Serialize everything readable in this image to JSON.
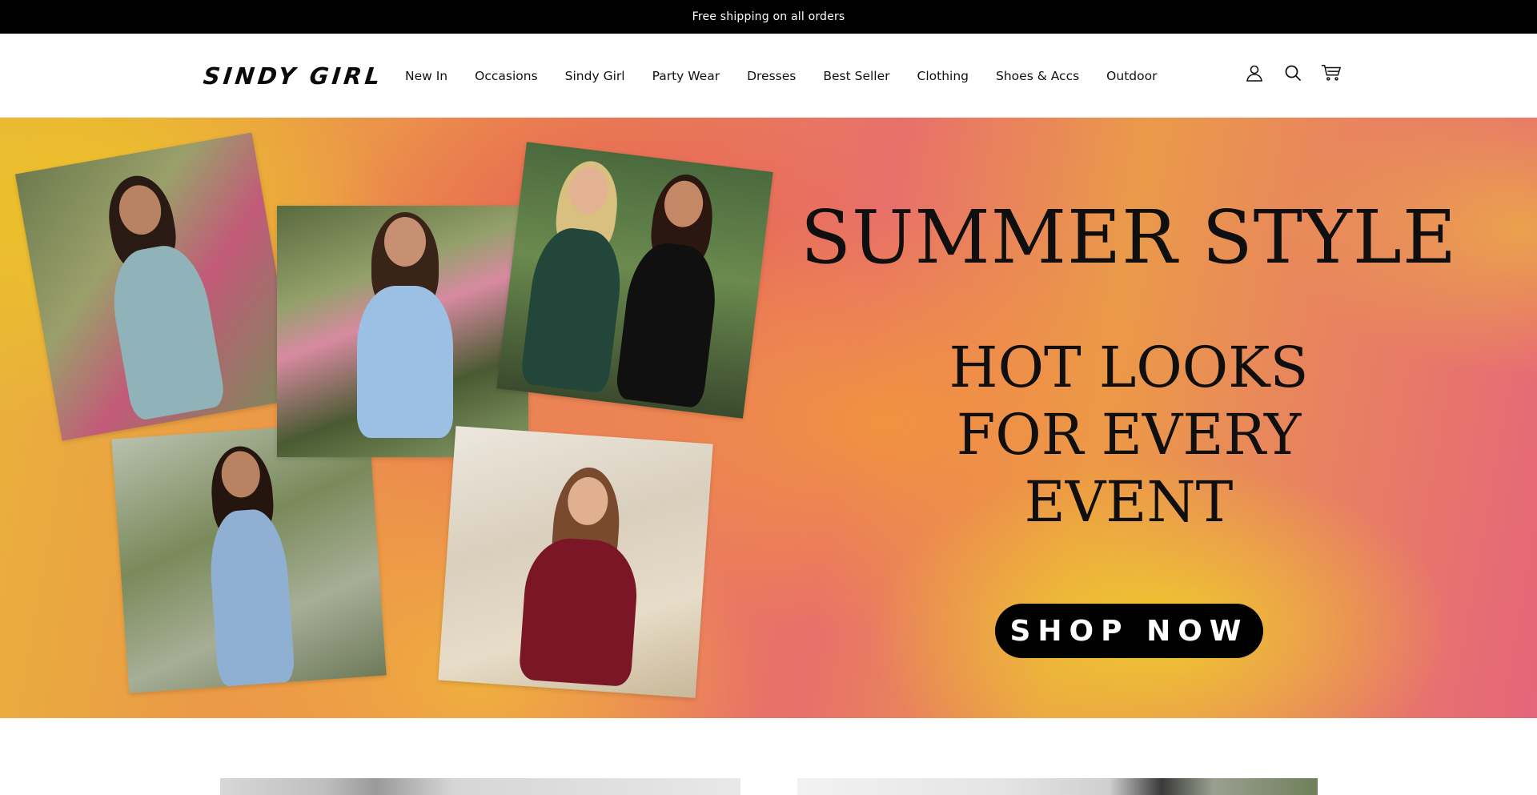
{
  "announcement": {
    "text": "Free shipping on all orders"
  },
  "header": {
    "logo": "SINDY GIRL",
    "nav": [
      {
        "label": "New In"
      },
      {
        "label": "Occasions"
      },
      {
        "label": "Sindy Girl"
      },
      {
        "label": "Party Wear"
      },
      {
        "label": "Dresses"
      },
      {
        "label": "Best Seller"
      },
      {
        "label": "Clothing"
      },
      {
        "label": "Shoes & Accs"
      },
      {
        "label": "Outdoor"
      }
    ],
    "icons": [
      "account-icon",
      "search-icon",
      "cart-icon"
    ]
  },
  "hero": {
    "headline": "SUMMER STYLE",
    "subheadline_lines": [
      "HOT LOOKS",
      "FOR EVERY",
      "EVENT"
    ],
    "cta": "SHOP NOW",
    "photos": [
      {
        "dress_color": "#8fb3b8"
      },
      {
        "dress_color": "#9cc0e3"
      },
      {
        "dress_color": "#22463a"
      },
      {
        "dress_color": "#8fb0d3"
      },
      {
        "dress_color": "#7a1626"
      }
    ]
  }
}
